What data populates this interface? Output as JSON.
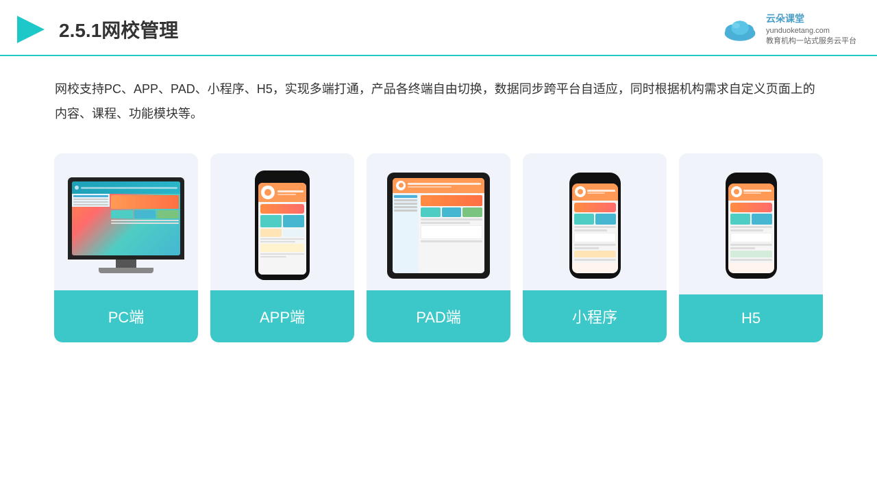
{
  "header": {
    "title": "2.5.1网校管理",
    "logo": {
      "name": "云朵课堂",
      "url_text": "yunduoketang.com",
      "tagline1": "教育机构一站",
      "tagline2": "式服务云平台"
    }
  },
  "description": {
    "text": "网校支持PC、APP、PAD、小程序、H5，实现多端打通，产品各终端自由切换，数据同步跨平台自适应，同时根据机构需求自定义页面上的内容、课程、功能模块等。"
  },
  "cards": [
    {
      "id": "pc",
      "label": "PC端",
      "type": "pc"
    },
    {
      "id": "app",
      "label": "APP端",
      "type": "phone"
    },
    {
      "id": "pad",
      "label": "PAD端",
      "type": "pad"
    },
    {
      "id": "miniprogram",
      "label": "小程序",
      "type": "smartphone"
    },
    {
      "id": "h5",
      "label": "H5",
      "type": "smartphone2"
    }
  ],
  "accent_color": "#3cc8c8"
}
